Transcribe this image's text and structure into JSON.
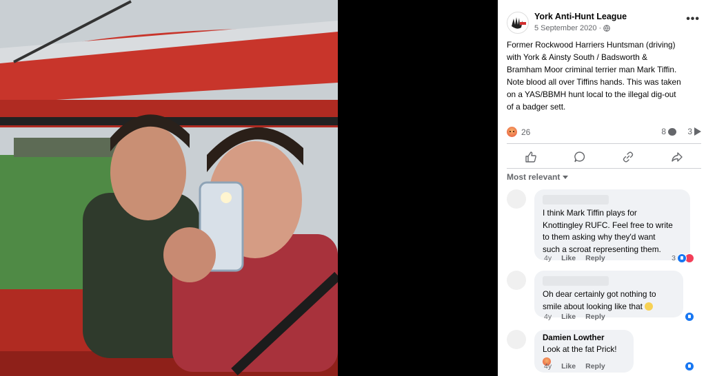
{
  "post": {
    "page_name": "York Anti-Hunt League",
    "date": "5 September 2020",
    "privacy_separator": "·",
    "text": "Former Rockwood Harriers Huntsman (driving)\nwith York & Ainsty South / Badsworth &\nBramham Moor criminal terrier man Mark Tiffin.\nNote blood all over Tiffins hands. This was taken\non a YAS/BBMH hunt local to the illegal dig-out\nof a badger sett.",
    "more_menu": "•••"
  },
  "stats": {
    "reactions": "26",
    "comments": "8",
    "shares": "3"
  },
  "actions": [
    "like-icon",
    "comment-icon",
    "link-icon",
    "share-icon"
  ],
  "comments_filter": "Most relevant",
  "comments": [
    {
      "name": "",
      "text": "I think Mark Tiffin plays for\nKnottingley RUFC. Feel free to write\nto them asking why they'd want\nsuch a scroat representing them.",
      "age": "4y",
      "like": "Like",
      "reply": "Reply",
      "reactions": "3"
    },
    {
      "name": "",
      "text": "Oh dear certainly got nothing to\nsmile about looking like that",
      "age": "4y",
      "like": "Like",
      "reply": "Reply",
      "reactions": ""
    },
    {
      "name": "Damien Lowther",
      "text": "Look at the fat Prick!",
      "age": "4y",
      "like": "Like",
      "reply": "Reply",
      "reactions": ""
    }
  ],
  "colors": {
    "facebook_blue": "#1877f2",
    "secondary_text": "#65676b",
    "car_red": "#c8352b"
  }
}
